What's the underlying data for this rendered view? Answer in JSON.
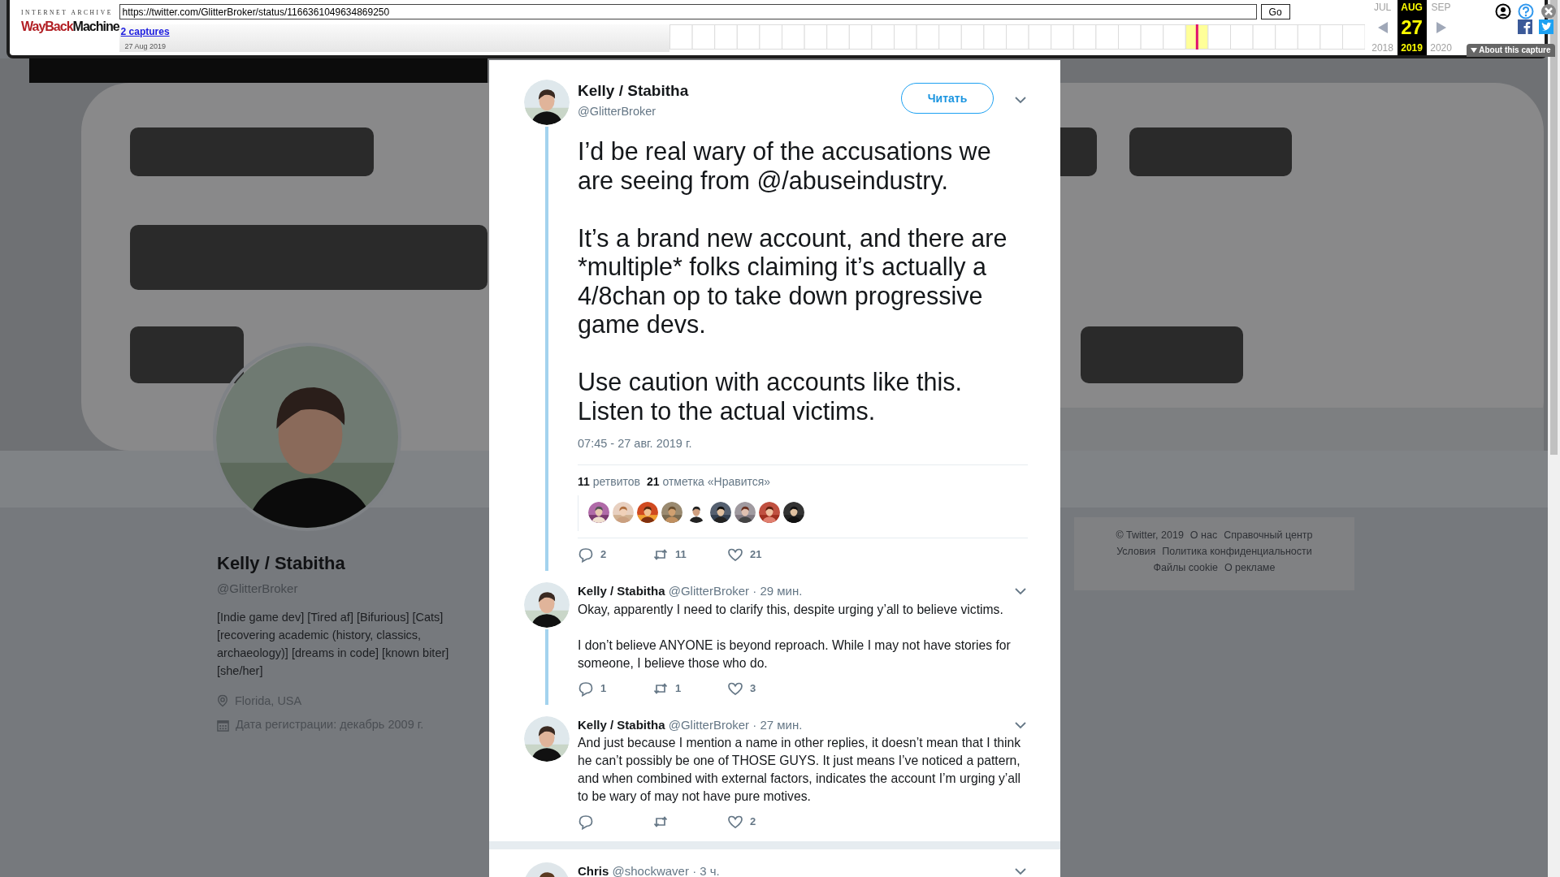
{
  "wayback": {
    "logo_top": "INTERNET ARCHIVE",
    "logo_wayback": "WayBack",
    "logo_machine": "Machine",
    "url": "https://twitter.com/GlitterBroker/status/1166361049634869250",
    "go_button": "Go",
    "captures_link": "2 captures",
    "capture_date": "27 Aug 2019",
    "calendar": {
      "prev_month": "JUL",
      "month": "AUG",
      "next_month": "SEP",
      "prev_year": "2018",
      "day": "27",
      "year": "2019",
      "next_year": "2020"
    },
    "about_button": "About this capture"
  },
  "profile": {
    "name": "Kelly / Stabitha",
    "handle": "@GlitterBroker",
    "bio": "[Indie game dev] [Tired af] [Bifurious] [Cats] [recovering academic (history, classics, archaeology)] [dreams in code] [known biter] [she/her]",
    "location": "Florida, USA",
    "joined": "Дата регистрации: декабрь 2009 г."
  },
  "footer_links": [
    [
      "© Twitter, 2019",
      "О нас",
      "Справочный центр"
    ],
    [
      "Условия",
      "Политика конфиденциальности"
    ],
    [
      "Файлы cookie",
      "О рекламе"
    ]
  ],
  "tweet": {
    "name": "Kelly / Stabitha",
    "handle": "@GlitterBroker",
    "follow_button": "Читать",
    "threaded": true,
    "paragraphs": [
      "I’d be real wary of the accusations we are seeing from @/abuseindustry.",
      "It’s a brand new account, and there are *multiple* folks claiming it’s actually a 4/8chan op to take down progressive game devs.",
      "Use caution with accounts like this. Listen to the actual victims."
    ],
    "timestamp": "07:45 - 27 авг. 2019 г.",
    "retweets": "**11** ретвитов",
    "likes": "**21** отметка «Нравится»",
    "actions": {
      "reply": "2",
      "retweet": "11",
      "like": "21"
    }
  },
  "replies": [
    {
      "name": "Kelly / Stabitha",
      "handle": "@GlitterBroker",
      "time": "· 29 мин.",
      "threaded": true,
      "paragraphs": [
        "Okay, apparently I need to clarify this, despite urging y’all to believe victims.",
        "I don’t believe ANYONE is beyond reproach. While I may not have stories for someone, I believe those who do."
      ],
      "actions": {
        "reply": "1",
        "retweet": "1",
        "like": "3"
      }
    },
    {
      "name": "Kelly / Stabitha",
      "handle": "@GlitterBroker",
      "time": "· 27 мин.",
      "threaded": false,
      "paragraphs": [
        "And just because I mention a name in other replies, it doesn’t mean that I think he can’t possibly be one of THOSE GUYS. It just means I’ve noticed a pattern, and when combined with external factors, indicates the account I’m urging y’all to be wary of may not have pure motives."
      ],
      "actions": {
        "like": "2"
      }
    },
    {
      "name": "Chris",
      "handle": "@shockwaver",
      "time": "· 3 ч.",
      "threaded": false,
      "separated": true
    }
  ]
}
